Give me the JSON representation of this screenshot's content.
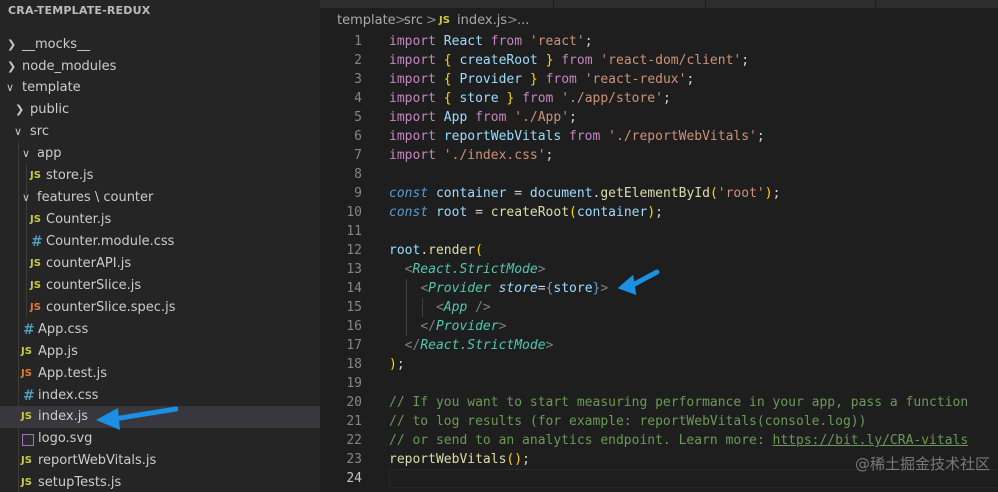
{
  "sidebar": {
    "title": "CRA-TEMPLATE-REDUX",
    "items": [
      {
        "label": "__mocks__",
        "kind": "folder",
        "expanded": false
      },
      {
        "label": "node_modules",
        "kind": "folder",
        "expanded": false
      },
      {
        "label": "template",
        "kind": "folder",
        "expanded": true
      },
      {
        "label": "public",
        "kind": "folder",
        "expanded": false
      },
      {
        "label": "src",
        "kind": "folder",
        "expanded": true
      },
      {
        "label": "app",
        "kind": "folder",
        "expanded": true
      },
      {
        "label": "store.js",
        "kind": "js",
        "icon_text": "JS"
      },
      {
        "label": "features \\ counter",
        "kind": "folder",
        "expanded": true
      },
      {
        "label": "Counter.js",
        "kind": "js",
        "icon_text": "JS"
      },
      {
        "label": "Counter.module.css",
        "kind": "css",
        "icon_text": "#"
      },
      {
        "label": "counterAPI.js",
        "kind": "js",
        "icon_text": "JS"
      },
      {
        "label": "counterSlice.js",
        "kind": "js",
        "icon_text": "JS"
      },
      {
        "label": "counterSlice.spec.js",
        "kind": "test",
        "icon_text": "JS"
      },
      {
        "label": "App.css",
        "kind": "css",
        "icon_text": "#"
      },
      {
        "label": "App.js",
        "kind": "js",
        "icon_text": "JS"
      },
      {
        "label": "App.test.js",
        "kind": "test",
        "icon_text": "JS"
      },
      {
        "label": "index.css",
        "kind": "css",
        "icon_text": "#"
      },
      {
        "label": "index.js",
        "kind": "js",
        "icon_text": "JS",
        "selected": true
      },
      {
        "label": "logo.svg",
        "kind": "svg"
      },
      {
        "label": "reportWebVitals.js",
        "kind": "js",
        "icon_text": "JS"
      },
      {
        "label": "setupTests.js",
        "kind": "js",
        "icon_text": "JS"
      }
    ]
  },
  "breadcrumb": {
    "part1": "template",
    "part2": "src",
    "icon_text": "JS",
    "part3": "index.js",
    "part4": "...",
    "separator": ">"
  },
  "editor": {
    "line_numbers": [
      "1",
      "2",
      "3",
      "4",
      "5",
      "6",
      "7",
      "8",
      "9",
      "10",
      "11",
      "12",
      "13",
      "14",
      "15",
      "16",
      "17",
      "18",
      "19",
      "20",
      "21",
      "22",
      "23",
      "24"
    ],
    "active_line": "24"
  },
  "watermark": "@稀土掘金技术社区",
  "colors": {
    "sidebar_bg": "#252526",
    "editor_bg": "#1e1e1e",
    "arrow": "#1a8fe3",
    "selection": "#37373d"
  }
}
